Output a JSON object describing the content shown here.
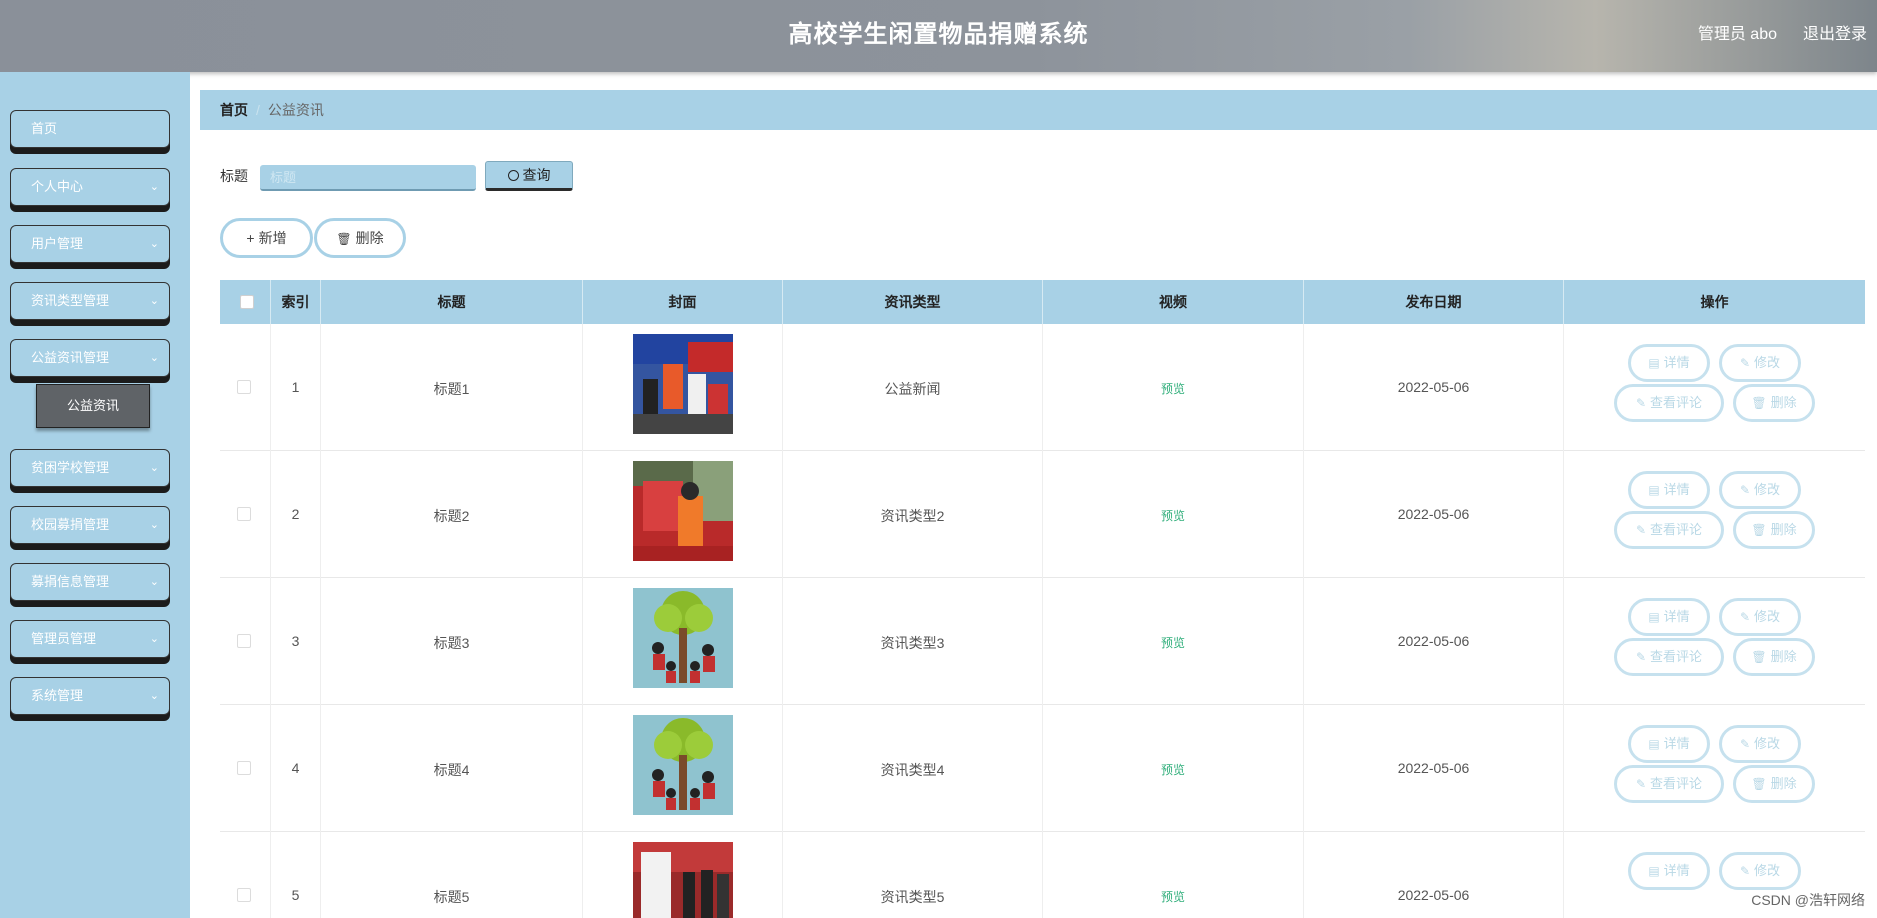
{
  "header": {
    "title": "高校学生闲置物品捐赠系统",
    "admin_label": "管理员 abo",
    "logout_label": "退出登录"
  },
  "sidebar": {
    "items": [
      {
        "label": "首页",
        "has_chevron": false
      },
      {
        "label": "个人中心",
        "has_chevron": true
      },
      {
        "label": "用户管理",
        "has_chevron": true
      },
      {
        "label": "资讯类型管理",
        "has_chevron": true
      },
      {
        "label": "公益资讯管理",
        "has_chevron": true
      },
      {
        "label": "贫困学校管理",
        "has_chevron": true
      },
      {
        "label": "校园募捐管理",
        "has_chevron": true
      },
      {
        "label": "募捐信息管理",
        "has_chevron": true
      },
      {
        "label": "管理员管理",
        "has_chevron": true
      },
      {
        "label": "系统管理",
        "has_chevron": true
      }
    ],
    "submenu_active": "公益资讯"
  },
  "breadcrumb": {
    "home": "首页",
    "separator": "/",
    "current": "公益资讯"
  },
  "search": {
    "label": "标题",
    "placeholder": "标题",
    "value": "",
    "query_label": "查询"
  },
  "actions": {
    "add_label": "新增",
    "delete_label": "删除"
  },
  "table": {
    "columns": [
      "索引",
      "标题",
      "封面",
      "资讯类型",
      "视频",
      "发布日期",
      "操作"
    ],
    "rows": [
      {
        "index": "1",
        "title": "标题1",
        "type": "公益新闻",
        "video": "预览",
        "date": "2022-05-06"
      },
      {
        "index": "2",
        "title": "标题2",
        "type": "资讯类型2",
        "video": "预览",
        "date": "2022-05-06"
      },
      {
        "index": "3",
        "title": "标题3",
        "type": "资讯类型3",
        "video": "预览",
        "date": "2022-05-06"
      },
      {
        "index": "4",
        "title": "标题4",
        "type": "资讯类型4",
        "video": "预览",
        "date": "2022-05-06"
      },
      {
        "index": "5",
        "title": "标题5",
        "type": "资讯类型5",
        "video": "预览",
        "date": "2022-05-06"
      }
    ],
    "op_labels": {
      "detail": "详情",
      "edit": "修改",
      "comments": "查看评论",
      "delete": "删除"
    }
  },
  "watermark": "CSDN @浩轩网络",
  "colors": {
    "accent": "#a8d1e6",
    "video_link": "#2fae7a",
    "active_submenu": "#5f6367"
  }
}
